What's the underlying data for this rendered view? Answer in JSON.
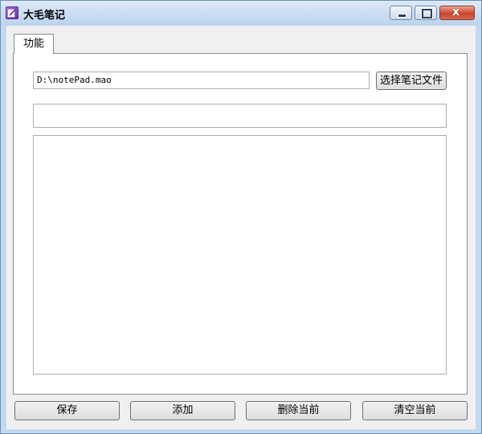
{
  "window": {
    "title": "大毛笔记",
    "icon": "notepad-pen-icon",
    "controls": {
      "minimize_icon": "minimize-icon",
      "maximize_icon": "maximize-icon",
      "close_icon": "close-icon",
      "close_glyph": "x"
    }
  },
  "tabs": [
    {
      "label": "功能",
      "active": true
    }
  ],
  "file": {
    "path_value": "D:\\notePad.mao",
    "choose_label": "选择笔记文件"
  },
  "note": {
    "title_value": "",
    "content_value": ""
  },
  "actions": {
    "save_label": "保存",
    "add_label": "添加",
    "delete_label": "删除当前",
    "clear_label": "清空当前"
  },
  "colors": {
    "title_bar": "#bcd3ee",
    "close_button": "#c9452e",
    "client_bg": "#f0f0f0"
  }
}
